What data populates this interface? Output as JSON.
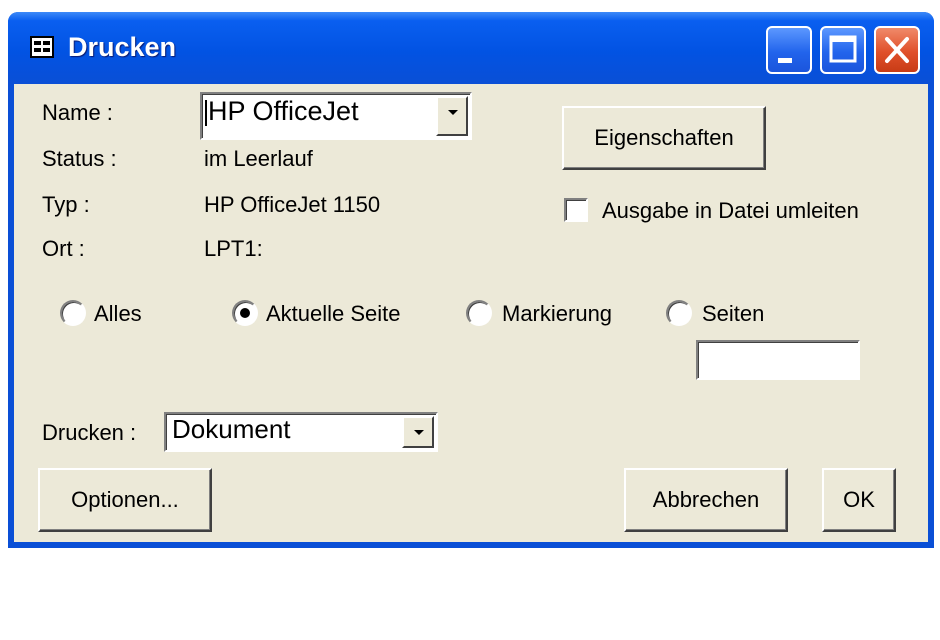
{
  "window": {
    "title": "Drucken",
    "colors": {
      "titlebar": "#0a4fd6",
      "close_button": "#e0502a",
      "client": "#ece9d8"
    }
  },
  "titlebar_icons": [
    "form-icon",
    "minimize-icon",
    "maximize-icon",
    "close-icon"
  ],
  "printer": {
    "name_label": "Name :",
    "name_value": "HP OfficeJet",
    "status_label": "Status :",
    "status_value": "im Leerlauf",
    "type_label": "Typ :",
    "type_value": "HP OfficeJet 1150",
    "location_label": "Ort :",
    "location_value": "LPT1:",
    "properties_button": "Eigenschaften",
    "print_to_file_label": "Ausgabe in Datei umleiten",
    "print_to_file_checked": false
  },
  "range": {
    "options": [
      {
        "label": "Alles",
        "checked": false
      },
      {
        "label": "Aktuelle Seite",
        "checked": true
      },
      {
        "label": "Markierung",
        "checked": false
      },
      {
        "label": "Seiten",
        "checked": false
      }
    ],
    "pages_value": ""
  },
  "print_what": {
    "label": "Drucken :",
    "value": "Dokument"
  },
  "buttons": {
    "options": "Optionen...",
    "cancel": "Abbrechen",
    "ok": "OK"
  }
}
